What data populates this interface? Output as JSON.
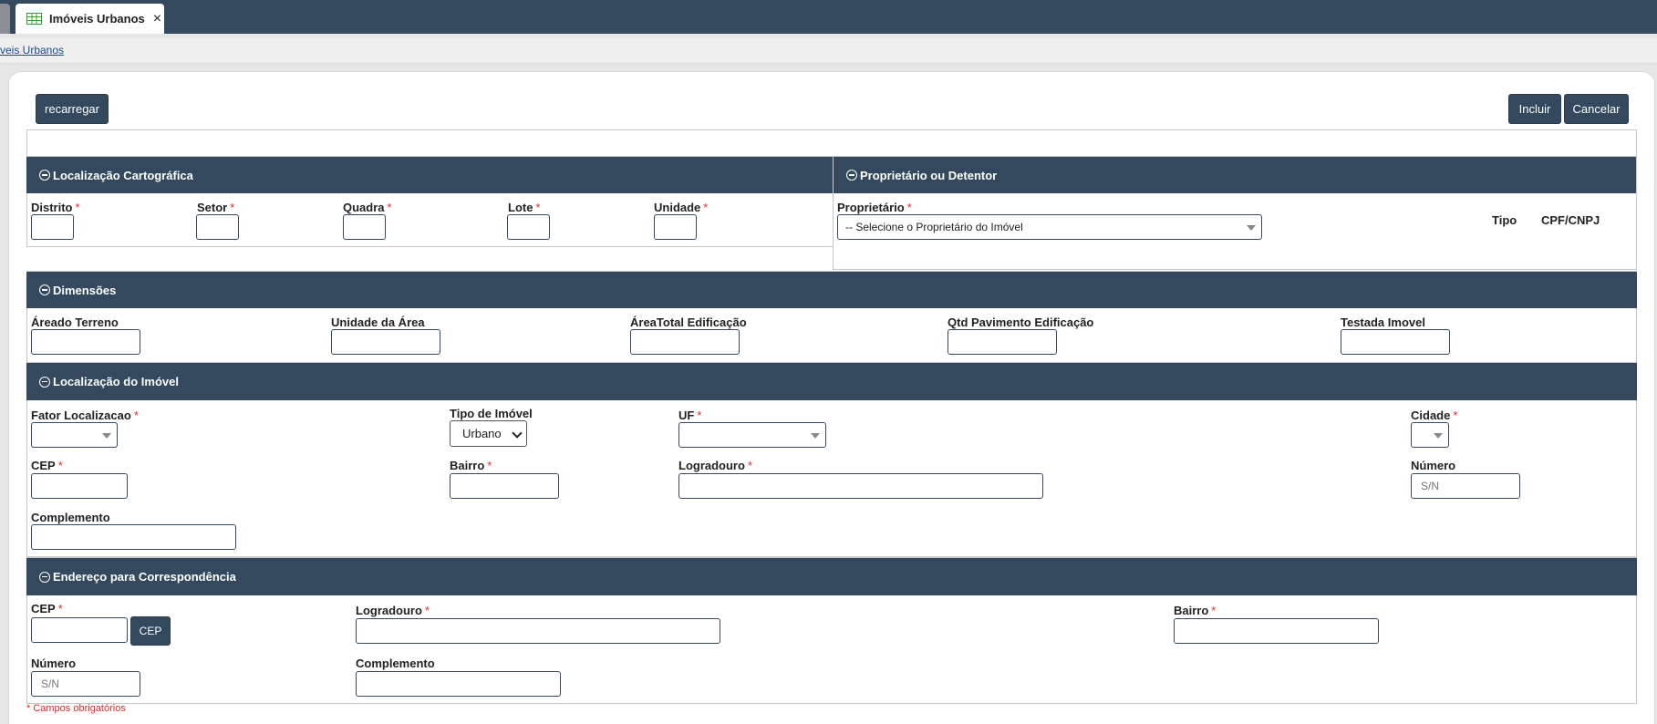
{
  "tabs": {
    "active_label": "Imóveis Urbanos"
  },
  "breadcrumb": {
    "link_text": "veis Urbanos"
  },
  "toolbar": {
    "reload_label": "recarregar",
    "include_label": "Incluir",
    "cancel_label": "Cancelar"
  },
  "required_mark": "*",
  "cartographic": {
    "title": "Localização Cartográfica",
    "distrito": "Distrito",
    "setor": "Setor",
    "quadra": "Quadra",
    "lote": "Lote",
    "unidade": "Unidade"
  },
  "owner": {
    "title": "Proprietário ou Detentor",
    "proprietario_label": "Proprietário",
    "proprietario_placeholder": "-- Selecione o Proprietário do Imóvel",
    "col_tipo": "Tipo",
    "col_cpf": "CPF/CNPJ"
  },
  "dimensions": {
    "title": "Dimensões",
    "area_terreno": "Áreado Terreno",
    "unidade_area": "Unidade da Área",
    "area_total": "ÁreaTotal Edificação",
    "qtd_pavimento": "Qtd Pavimento Edificação",
    "testada": "Testada Imovel"
  },
  "location": {
    "title": "Localização do Imóvel",
    "fator": "Fator Localizacao",
    "tipo_imovel": "Tipo de Imóvel",
    "tipo_imovel_value": "Urbano",
    "uf": "UF",
    "cidade": "Cidade",
    "cep": "CEP",
    "bairro": "Bairro",
    "logradouro": "Logradouro",
    "numero": "Número",
    "numero_placeholder": "S/N",
    "complemento": "Complemento"
  },
  "correspondence": {
    "title": "Endereço para Correspondência",
    "cep": "CEP",
    "cep_button": "CEP",
    "logradouro": "Logradouro",
    "bairro": "Bairro",
    "numero": "Número",
    "numero_placeholder": "S/N",
    "complemento": "Complemento"
  },
  "footer": {
    "required_note": "* Campos obrigatórios"
  },
  "colors": {
    "header_bg": "#34495e",
    "required": "#d92b2b",
    "link": "#1a4a8a"
  }
}
